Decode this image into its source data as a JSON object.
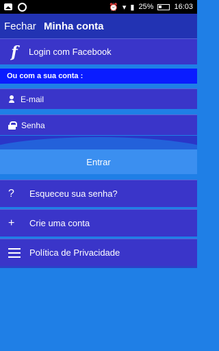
{
  "statusbar": {
    "battery": "25%",
    "time": "16:03"
  },
  "toolbar": {
    "close_label": "Fechar",
    "title": "Minha conta"
  },
  "facebook": {
    "icon": "f",
    "label": "Login com Facebook"
  },
  "account_section": {
    "header": "Ou com a sua conta :",
    "email_placeholder": "E-mail",
    "password_placeholder": "Senha"
  },
  "login_button": "Entrar",
  "menu": {
    "forgot": {
      "icon": "?",
      "label": "Esqueceu sua senha?"
    },
    "create": {
      "icon": "+",
      "label": "Crie uma conta"
    },
    "privacy": {
      "label": "Política de Privacidade"
    }
  },
  "colors": {
    "toolbar": "#2233b3",
    "row": "#3a35c9",
    "section_header": "#0a1cff",
    "background": "#1f7fe6"
  }
}
